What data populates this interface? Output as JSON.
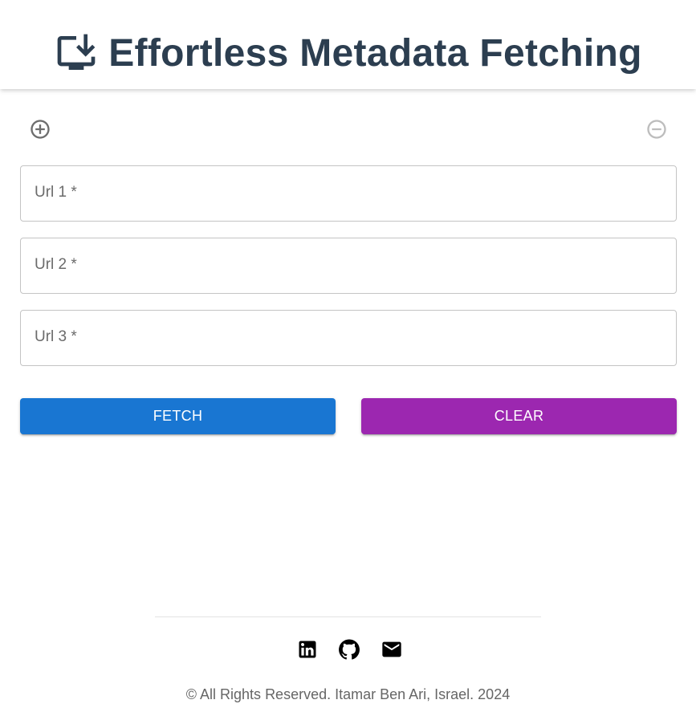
{
  "header": {
    "title": "Effortless Metadata Fetching",
    "icon": "download-to-desktop-icon",
    "title_color": "#2c3e50"
  },
  "controls": {
    "add_icon": "add-circle-outline-icon",
    "remove_icon": "remove-circle-outline-icon",
    "remove_enabled": false
  },
  "form": {
    "fields": [
      {
        "label": "Url 1 *",
        "value": ""
      },
      {
        "label": "Url 2 *",
        "value": ""
      },
      {
        "label": "Url 3 *",
        "value": ""
      }
    ],
    "fetch_label": "FETCH",
    "clear_label": "CLEAR",
    "fetch_color": "#1976d2",
    "clear_color": "#9c27b0"
  },
  "footer": {
    "social": [
      {
        "icon": "linkedin-icon"
      },
      {
        "icon": "github-icon"
      },
      {
        "icon": "email-icon"
      }
    ],
    "copyright": "© All Rights Reserved. Itamar Ben Ari, Israel. 2024"
  }
}
